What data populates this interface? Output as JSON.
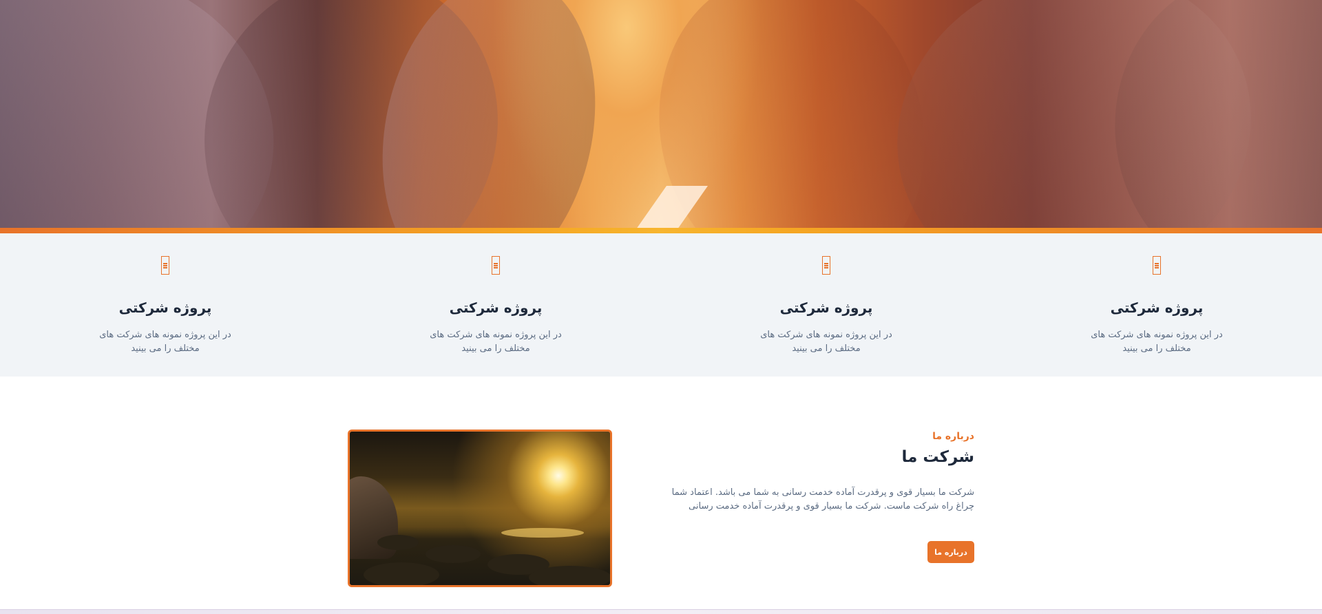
{
  "hero": {
    "image": "antelope-canyon-photo"
  },
  "features": [
    {
      "icon": "broken-image-icon",
      "title": "پروژه شرکتی",
      "text": "در این پروژه نمونه های شرکت های مختلف را می بینید"
    },
    {
      "icon": "broken-image-icon",
      "title": "پروژه شرکتی",
      "text": "در این پروژه نمونه های شرکت های مختلف را می بینید"
    },
    {
      "icon": "broken-image-icon",
      "title": "پروژه شرکتی",
      "text": "در این پروژه نمونه های شرکت های مختلف را می بینید"
    },
    {
      "icon": "broken-image-icon",
      "title": "پروژه شرکتی",
      "text": "در این پروژه نمونه های شرکت های مختلف را می بینید"
    }
  ],
  "about": {
    "kicker": "درباره ما",
    "title": "شرکت ما",
    "text": "شرکت ما بسیار قوی و پرقدرت آماده خدمت رسانی به شما می باشد. اعتماد شما چراغ راه شرکت ماست. شرکت ما بسیار قوی و پرقدرت آماده خدمت رسانی",
    "button_label": "درباره ما",
    "image": "sunset-shore-photo"
  },
  "colors": {
    "accent": "#e8732a",
    "features_bg": "#f1f4f7",
    "heading": "#1e293b",
    "body_text": "#5b6b82"
  }
}
